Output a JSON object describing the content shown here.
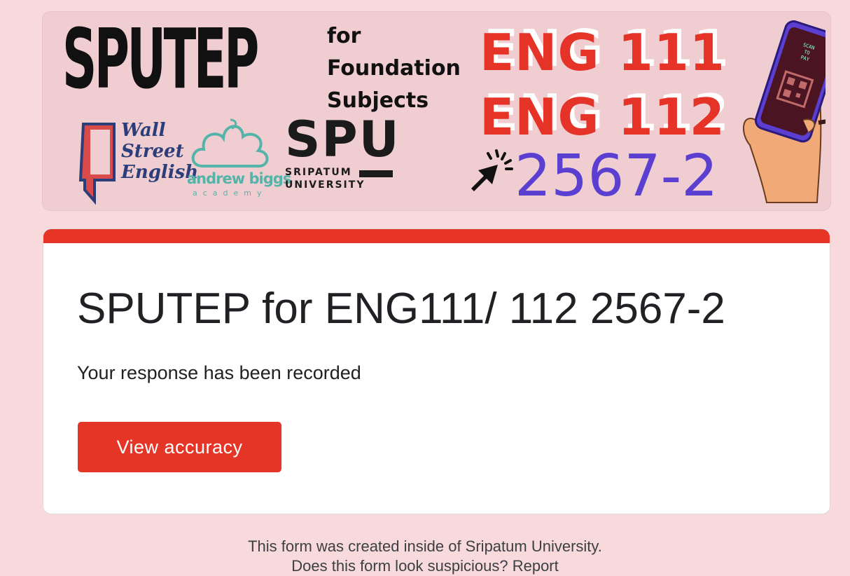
{
  "banner": {
    "title": "SPUTEP",
    "subtitle_lines": [
      "for",
      "Foundation",
      "Subjects"
    ],
    "wse_lines": [
      "Wall",
      "Street",
      "English"
    ],
    "ab_name": "andrew biggs",
    "ab_sub": "academy",
    "spu_logo": "SPU",
    "spu_name_lines": [
      "SRIPATUM",
      "UNIVERSITY"
    ],
    "eng1": "ENG 111",
    "eng2": "ENG 112",
    "year": "2567-2",
    "scan_lines": [
      "SCAN",
      "TO",
      "PAY"
    ]
  },
  "form": {
    "title": "SPUTEP for ENG111/ 112 2567-2",
    "message": "Your response has been recorded",
    "button_label": "View accuracy"
  },
  "footer": {
    "line1": "This form was created inside of Sripatum University.",
    "line2": "Does this form look suspicious? Report"
  },
  "colors": {
    "page_bg": "#f8dadc",
    "accent_red": "#e53526",
    "year_purple": "#5b3fd1",
    "teal": "#55b4a9"
  }
}
